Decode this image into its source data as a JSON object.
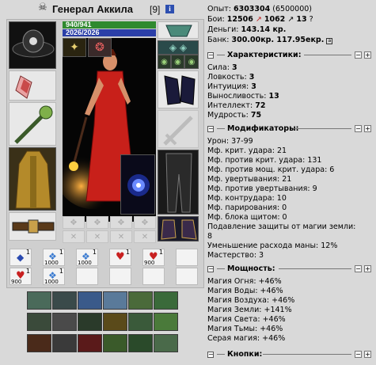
{
  "header": {
    "skull_icon": "skull-icon",
    "name": "Генерал Аккила",
    "level": "[9]",
    "info": "i"
  },
  "bars": {
    "hp": "940/941",
    "mana": "2026/2026",
    "hp_color": "#2f8a2f",
    "mana_color": "#2b3fa8"
  },
  "stats": {
    "experience": {
      "label": "Опыт:",
      "value": "6303304",
      "extra": "(6500000)"
    },
    "battles": {
      "label": "Бои:",
      "wins": "12506",
      "losses": "1062",
      "draws": "13",
      "q": "?"
    },
    "money": {
      "label": "Деньги:",
      "value": "143.14 кр."
    },
    "bank": {
      "label": "Банк:",
      "value": "300.00кр. 117.95екр."
    }
  },
  "characteristics": {
    "title": "Характеристики:",
    "items": [
      {
        "label": "Сила:",
        "value": "3"
      },
      {
        "label": "Ловкость:",
        "value": "3"
      },
      {
        "label": "Интуиция:",
        "value": "3"
      },
      {
        "label": "Выносливость:",
        "value": "13"
      },
      {
        "label": "Интеллект:",
        "value": "72"
      },
      {
        "label": "Мудрость:",
        "value": "75"
      }
    ]
  },
  "modifiers": {
    "title": "Модификаторы:",
    "items": [
      "Урон: 37-99",
      "Мф. крит. удара: 21",
      "Мф. против крит. удара: 131",
      "Мф. против мощ. крит. удара: 6",
      "Мф. увертывания: 21",
      "Мф. против увертывания: 9",
      "Мф. контрудара: 10",
      "Мф. парирования: 0",
      "Мф. блока щитом: 0",
      "Подавление защиты от магии земли:",
      "8",
      "Уменьшение расхода маны: 12%",
      "Мастерство: 3"
    ]
  },
  "powers": {
    "title": "Мощность:",
    "items": [
      "Магия Огня: +46%",
      "Магия Воды: +46%",
      "Магия Воздуха: +46%",
      "Магия Земли: +141%",
      "Магия Света: +46%",
      "Магия Тьмы: +46%",
      "Серая магия: +46%"
    ]
  },
  "buttons_section": {
    "title": "Кнопки:"
  },
  "scrolls": [
    {
      "count": "1",
      "sub": ""
    },
    {
      "count": "1",
      "sub": "1000"
    },
    {
      "count": "1",
      "sub": "1000"
    },
    {
      "count": "1",
      "sub": ""
    },
    {
      "count": "1",
      "sub": "900"
    },
    {
      "count": "",
      "sub": ""
    },
    {
      "count": "1",
      "sub": "900"
    },
    {
      "count": "1",
      "sub": "1000"
    }
  ]
}
